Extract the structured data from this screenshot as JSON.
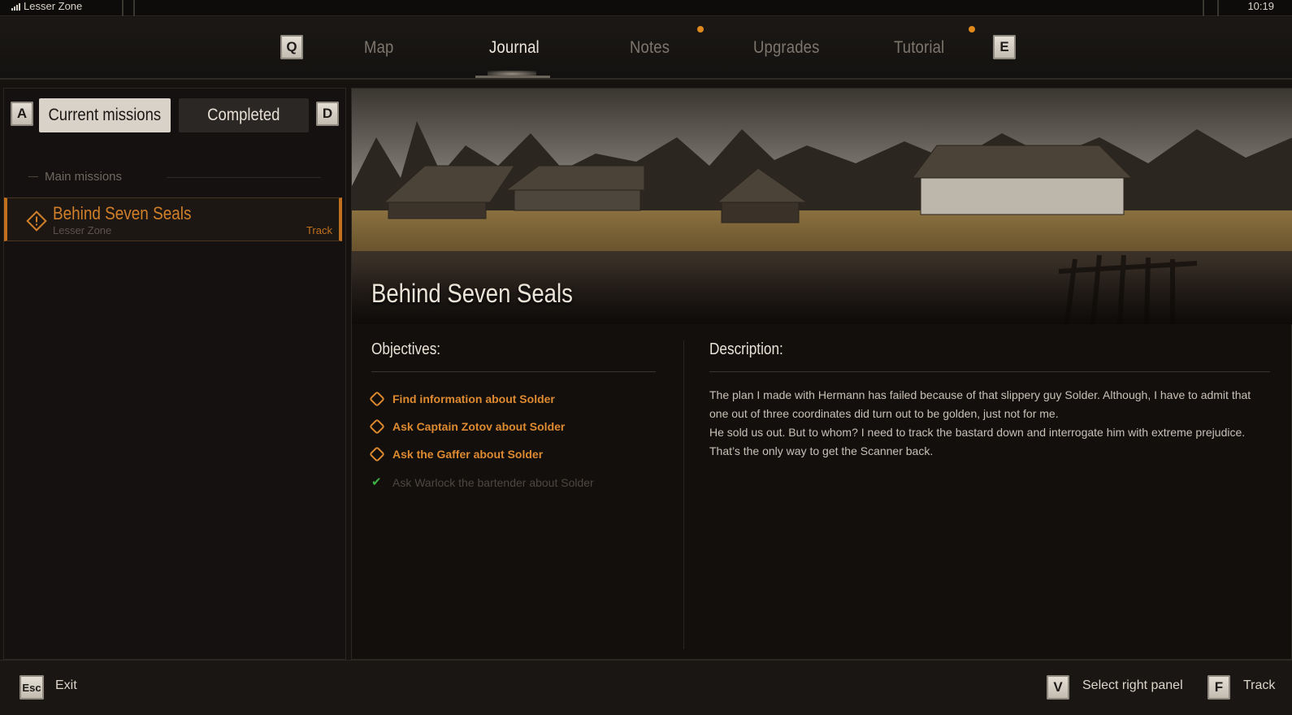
{
  "status_bar": {
    "zone": "Lesser Zone",
    "time": "10:19"
  },
  "nav": {
    "prev_key": "Q",
    "next_key": "E",
    "tabs": [
      {
        "label": "Map",
        "active": false,
        "notification": false
      },
      {
        "label": "Journal",
        "active": true,
        "notification": false
      },
      {
        "label": "Notes",
        "active": false,
        "notification": true
      },
      {
        "label": "Upgrades",
        "active": false,
        "notification": false
      },
      {
        "label": "Tutorial",
        "active": false,
        "notification": true
      }
    ]
  },
  "left_panel": {
    "filter_prev_key": "A",
    "filter_next_key": "D",
    "filters": {
      "current": "Current missions",
      "completed": "Completed"
    },
    "section_title": "Main missions",
    "missions": [
      {
        "title": "Behind Seven Seals",
        "location": "Lesser Zone",
        "action": "Track",
        "icon": "warning-diamond-icon"
      }
    ]
  },
  "detail": {
    "title": "Behind Seven Seals",
    "objectives_label": "Objectives:",
    "description_label": "Description:",
    "objectives": [
      {
        "text": "Find information about Solder",
        "done": false
      },
      {
        "text": "Ask Captain Zotov about Solder",
        "done": false
      },
      {
        "text": "Ask the Gaffer about Solder",
        "done": false
      },
      {
        "text": "Ask Warlock the bartender about Solder",
        "done": true
      }
    ],
    "description": [
      "The plan I made with Hermann has failed because of that slippery guy Solder. Although, I have to admit that one out of three coordinates did turn out to be golden, just not for me.",
      "He sold us out. But to whom? I need to track the bastard down and interrogate him with extreme prejudice. That’s the only way to get the Scanner back."
    ]
  },
  "bottom_bar": {
    "exit": {
      "key": "Esc",
      "label": "Exit"
    },
    "select_panel": {
      "key": "V",
      "label": "Select right panel"
    },
    "track": {
      "key": "F",
      "label": "Track"
    }
  },
  "colors": {
    "accent": "#de8a30",
    "notification": "#e08a1e",
    "done_check": "#3fb045"
  }
}
